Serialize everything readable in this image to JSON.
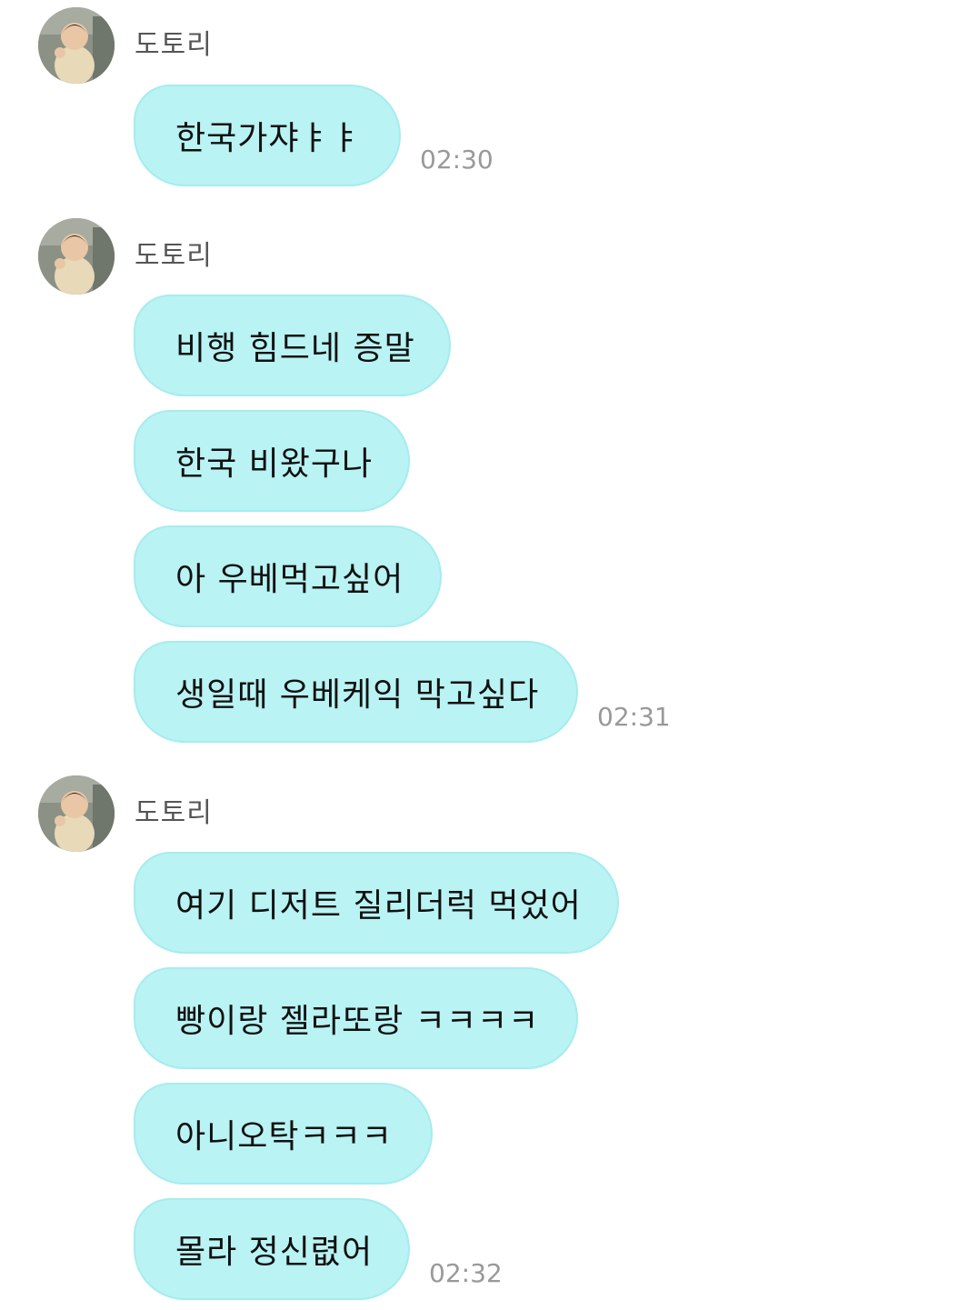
{
  "groups": [
    {
      "sender": "도토리",
      "messages": [
        "한국가쟈ㅑㅑ"
      ],
      "time": "02:30"
    },
    {
      "sender": "도토리",
      "messages": [
        "비행 힘드네 증말",
        "한국 비왔구나",
        "아 우베먹고싶어",
        "생일때 우베케익 막고싶다"
      ],
      "time": "02:31"
    },
    {
      "sender": "도토리",
      "messages": [
        "여기 디저트 질리더럭 먹었어",
        "빵이랑 젤라또랑 ㅋㅋㅋㅋ",
        "아니오탁ㅋㅋㅋ",
        "몰라 정신렶어"
      ],
      "time": "02:32"
    }
  ],
  "colors": {
    "bubble": "#b9f3f4",
    "bubble_border": "#a6ecee",
    "sender_text": "#555555",
    "time_text": "#999999"
  }
}
